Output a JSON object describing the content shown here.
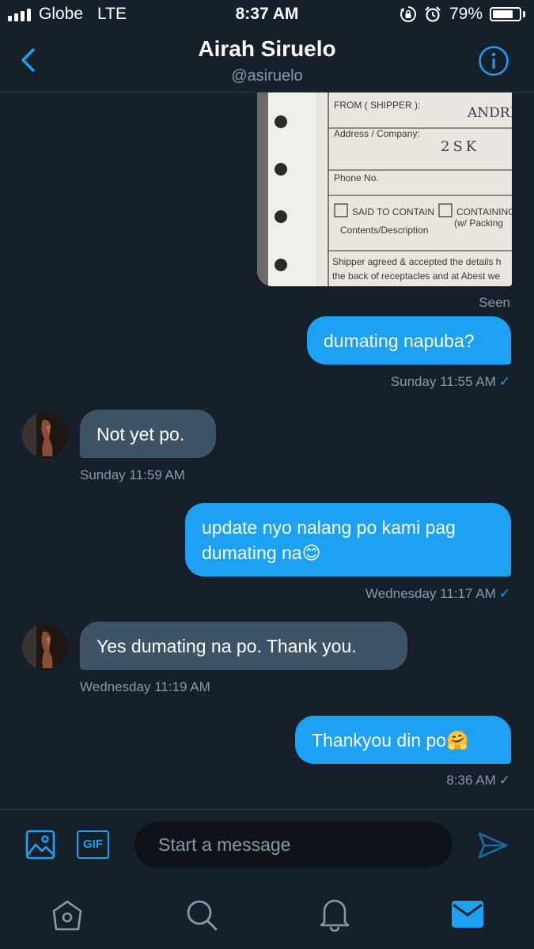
{
  "status_bar": {
    "carrier": "Globe",
    "network": "LTE",
    "time": "8:37 AM",
    "battery_percent": "79%",
    "battery_level": 0.79
  },
  "header": {
    "name": "Airah Siruelo",
    "handle": "@asiruelo"
  },
  "conversation": {
    "image_receipt": {
      "from_label": "FROM ( SHIPPER ):",
      "from_value": "ANDRE",
      "address_label": "Address / Company:",
      "address_value": "2SK",
      "phone_label": "Phone No.",
      "said_to_contain": "SAID TO CONTAIN",
      "containing": "CONTAINING",
      "w_packing": "(w/ Packing",
      "contents": "Contents/Description",
      "agreement_line1": "Shipper agreed & accepted the details h",
      "agreement_line2": "the back of receptacles and at Abest we"
    },
    "seen_label": "Seen",
    "messages": [
      {
        "text": "dumating napuba?",
        "meta": "Sunday 11:55 AM",
        "check": "✓"
      },
      {
        "text": "Not yet po.",
        "meta": "Sunday 11:59 AM"
      },
      {
        "text_line1": "update nyo nalang po kami pag",
        "text_line2": "dumating na😊",
        "meta": "Wednesday 11:17 AM",
        "check": "✓"
      },
      {
        "text": "Yes dumating na po. Thank you.",
        "meta": "Wednesday 11:19 AM"
      },
      {
        "text": "Thankyou din po🤗",
        "meta": "8:36 AM",
        "check": "✓"
      }
    ]
  },
  "composer": {
    "gif_label": "GIF",
    "placeholder": "Start a message"
  },
  "icons": {
    "back": "chevron-left-icon",
    "info": "info-icon",
    "image": "image-icon",
    "gif": "gif-icon",
    "send": "send-icon",
    "home": "home-icon",
    "search": "search-icon",
    "notifications": "bell-icon",
    "messages": "mail-icon"
  },
  "colors": {
    "background": "#15202b",
    "accent": "#1da1f2",
    "incoming_bubble": "#3d5466",
    "muted_text": "#8899a6"
  }
}
